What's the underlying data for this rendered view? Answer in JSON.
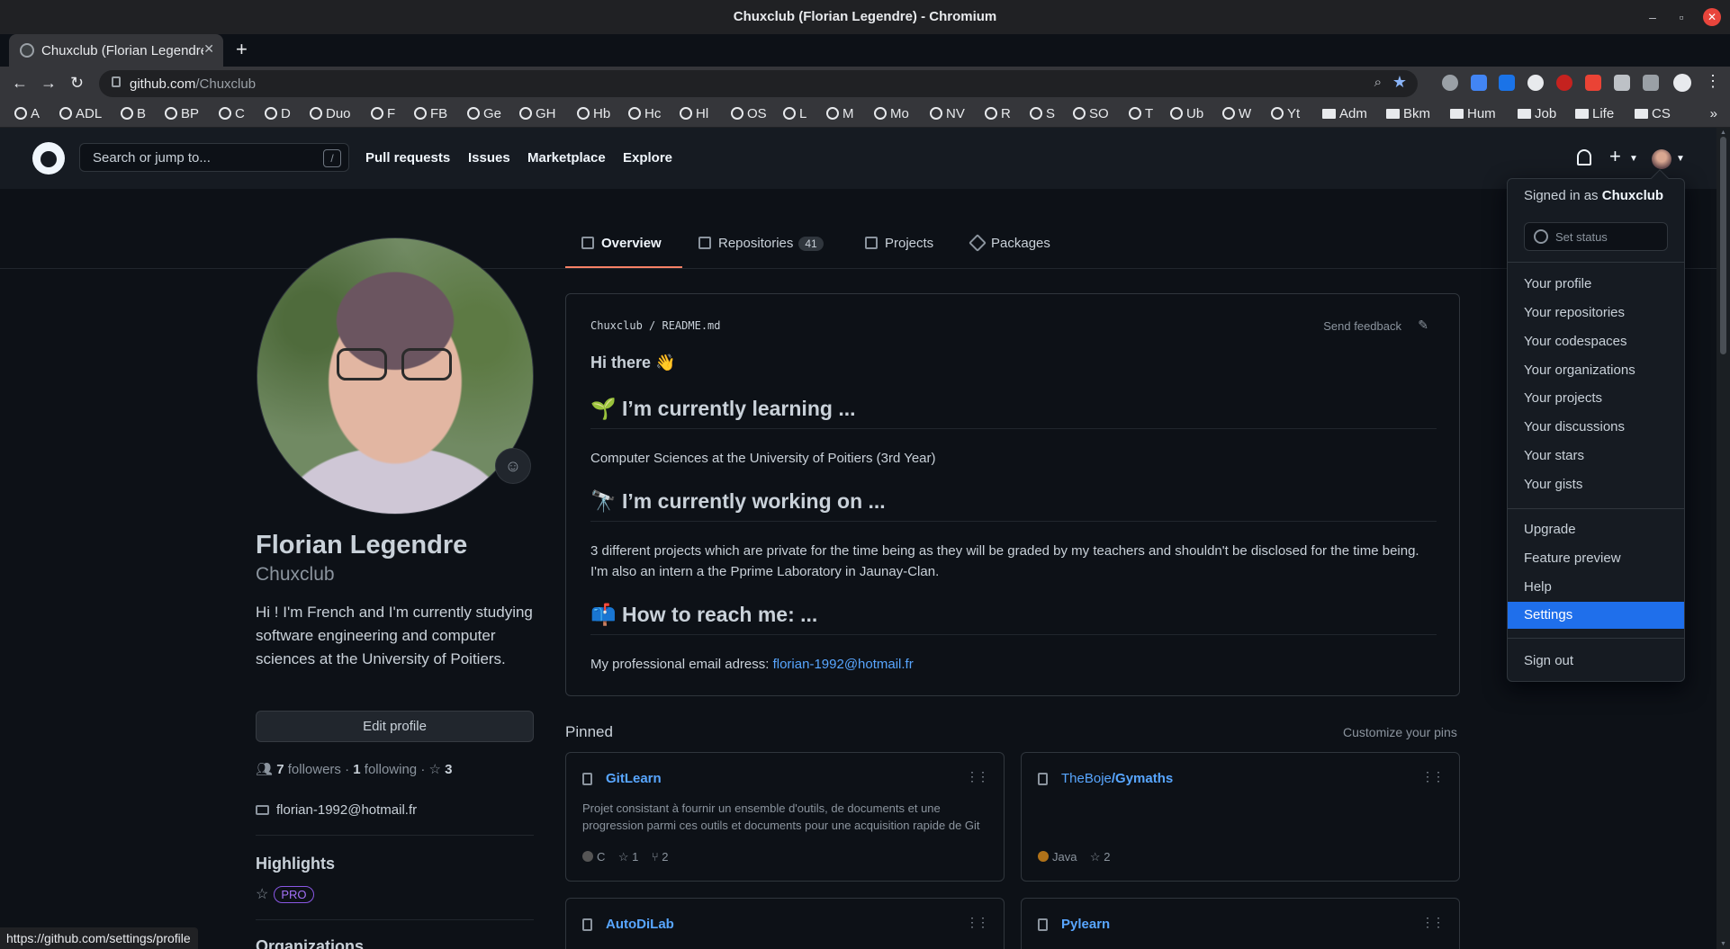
{
  "window": {
    "title": "Chuxclub (Florian Legendre) - Chromium"
  },
  "tab": {
    "label": "Chuxclub (Florian Legendre) - GitHub"
  },
  "address_bar": {
    "host": "github.com",
    "path": "/Chuxclub"
  },
  "bookmarks": {
    "items": [
      "A",
      "ADL",
      "B",
      "BP",
      "C",
      "D",
      "Duo",
      "F",
      "FB",
      "Ge",
      "GH",
      "Hb",
      "Hc",
      "Hl",
      "OS",
      "L",
      "M",
      "Mo",
      "NV",
      "R",
      "S",
      "SO",
      "T",
      "Ub",
      "W",
      "Yt"
    ],
    "folders": [
      "Adm",
      "Bkm",
      "Hum",
      "Job",
      "Life",
      "CS"
    ],
    "more": "»"
  },
  "header": {
    "search_placeholder": "Search or jump to...",
    "search_key": "/",
    "nav": [
      "Pull requests",
      "Issues",
      "Marketplace",
      "Explore"
    ]
  },
  "profile_tabs": {
    "overview": "Overview",
    "repositories": "Repositories",
    "repositories_count": "41",
    "projects": "Projects",
    "packages": "Packages"
  },
  "profile": {
    "name": "Florian Legendre",
    "login": "Chuxclub",
    "bio": "Hi ! I'm French and I'm currently studying software engineering and computer sciences at the University of Poitiers.",
    "edit_label": "Edit profile",
    "followers_count": "7",
    "followers_label": "followers",
    "following_count": "1",
    "following_label": "following",
    "stars_count": "3",
    "email": "florian-1992@hotmail.fr",
    "highlights_title": "Highlights",
    "pro_badge": "PRO",
    "orgs_title": "Organizations"
  },
  "readme": {
    "owner": "Chuxclub",
    "file": "README.md",
    "feedback": "Send feedback",
    "greeting": "Hi there 👋",
    "h_learning": "🌱 I’m currently learning ...",
    "p_learning": "Computer Sciences at the University of Poitiers (3rd Year)",
    "h_working": "🔭 I’m currently working on ...",
    "p_working": "3 different projects which are private for the time being as they will be graded by my teachers and shouldn't be disclosed for the time being. I'm also an intern a the Pprime Laboratory in Jaunay-Clan.",
    "h_reach": "📫 How to reach me: ...",
    "p_reach_prefix": "My professional email adress: ",
    "p_reach_email": "florian-1992@hotmail.fr"
  },
  "pinned": {
    "title": "Pinned",
    "customize": "Customize your pins",
    "repos": [
      {
        "owner": "",
        "name": "GitLearn",
        "description": "Projet consistant à fournir un ensemble d'outils, de documents et une progression parmi ces outils et documents pour une acquisition rapide de Git",
        "language": "C",
        "language_color": "#555555",
        "stars": "1",
        "forks": "2"
      },
      {
        "owner": "TheBoje",
        "name": "/Gymaths",
        "description": "",
        "language": "Java",
        "language_color": "#b07219",
        "stars": "2",
        "forks": ""
      },
      {
        "owner": "",
        "name": "AutoDiLab",
        "description": "",
        "language": "",
        "language_color": "",
        "stars": "",
        "forks": ""
      },
      {
        "owner": "",
        "name": "Pylearn",
        "description": "",
        "language": "",
        "language_color": "",
        "stars": "",
        "forks": ""
      }
    ]
  },
  "dropdown": {
    "signed_in_prefix": "Signed in as ",
    "signed_in_user": "Chuxclub",
    "set_status": "Set status",
    "items": [
      "Your profile",
      "Your repositories",
      "Your codespaces",
      "Your organizations",
      "Your projects",
      "Your discussions",
      "Your stars",
      "Your gists"
    ],
    "items2": [
      "Upgrade",
      "Feature preview",
      "Help",
      "Settings"
    ],
    "sign_out": "Sign out"
  },
  "statusbar": {
    "url": "https://github.com/settings/profile"
  },
  "colors": {
    "accent": "#1f6feb",
    "link": "#58a6ff",
    "underline": "#f78166",
    "background": "#0d1117"
  }
}
